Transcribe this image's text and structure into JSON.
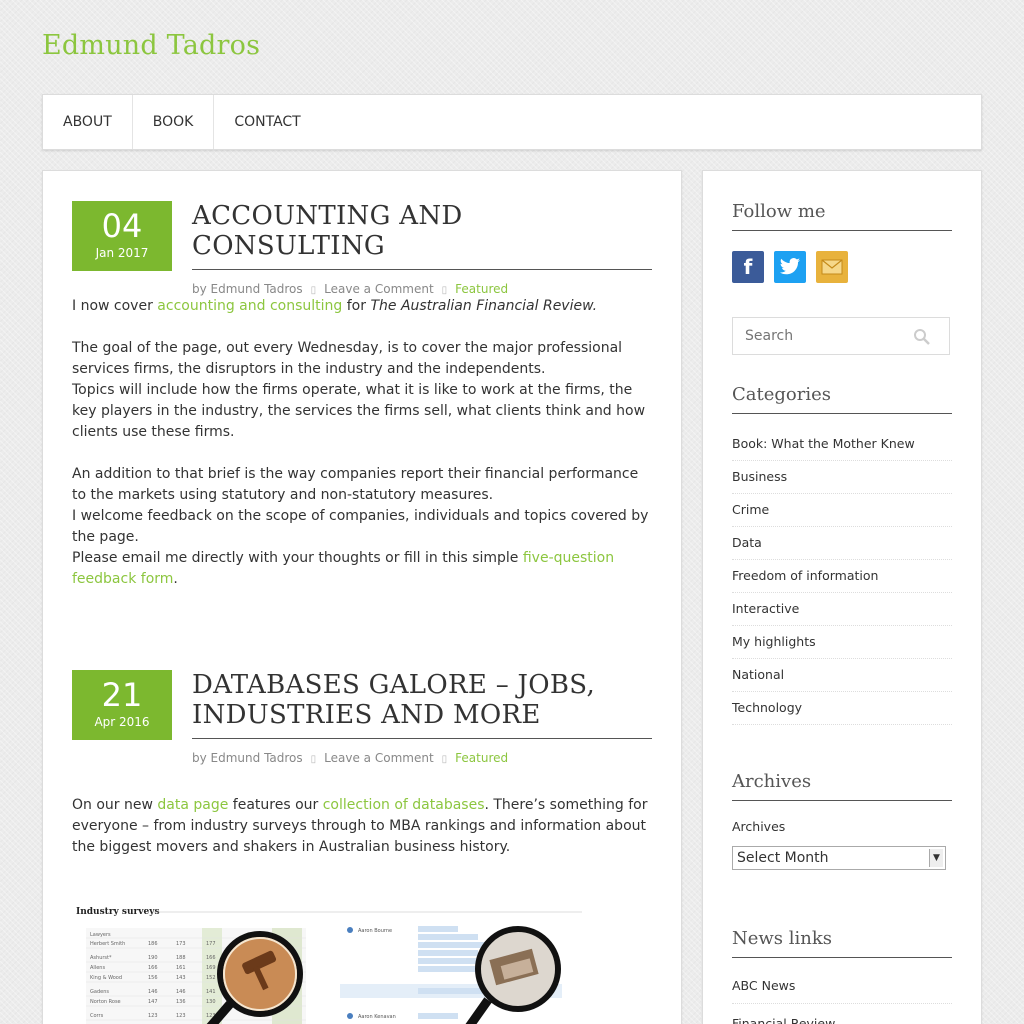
{
  "site": {
    "title": "Edmund Tadros"
  },
  "nav": {
    "items": [
      "ABOUT",
      "BOOK",
      "CONTACT"
    ]
  },
  "posts": [
    {
      "day": "04",
      "month": "Jan 2017",
      "title": "ACCOUNTING AND CONSULTING",
      "author": "by Edmund Tadros",
      "comment": "Leave a Comment",
      "category": "Featured",
      "p1_pre": "I now cover ",
      "p1_link": "accounting and consulting",
      "p1_mid": " for ",
      "p1_em": "The Australian Financial Review.",
      "p2a": "The goal of the page, out every Wednesday, is to cover the major professional services firms, the disruptors in the industry and the independents.",
      "p2b": "Topics will include how the firms operate, what it is like to work at the firms, the key players in the industry, the services the firms sell, what clients think and how clients use these firms.",
      "p3a": "An addition to that brief is the way companies report their financial performance to the markets using statutory and non-statutory measures.",
      "p3b": "I welcome feedback on the scope of companies, individuals and topics covered by the page.",
      "p3c_pre": "Please email me directly with your thoughts or fill in this simple ",
      "p3c_link": "five-question feedback form",
      "p3c_post": "."
    },
    {
      "day": "21",
      "month": "Apr 2016",
      "title": "DATABASES GALORE – JOBS, INDUSTRIES AND MORE",
      "author": "by Edmund Tadros",
      "comment": "Leave a Comment",
      "category": "Featured",
      "p1_pre": "On our new ",
      "p1_link": "data page",
      "p1_mid": " features our ",
      "p1_link2": "collection of databases",
      "p1_post": ". There’s something for everyone – from industry surveys through to MBA rankings and information about the biggest movers and shakers in Australian business history.",
      "image_heading": "Industry surveys"
    }
  ],
  "sidebar": {
    "follow_title": "Follow me",
    "social": [
      {
        "name": "facebook-icon",
        "glyph": "f"
      },
      {
        "name": "twitter-icon",
        "glyph": "t"
      },
      {
        "name": "email-icon",
        "glyph": "✉"
      }
    ],
    "search_placeholder": "Search",
    "categories_title": "Categories",
    "categories": [
      "Book: What the Mother Knew",
      "Business",
      "Crime",
      "Data",
      "Freedom of information",
      "Interactive",
      "My highlights",
      "National",
      "Technology"
    ],
    "archives_title": "Archives",
    "archives_label": "Archives",
    "archives_select": "Select Month",
    "news_title": "News links",
    "news": [
      "ABC News",
      "Financial Review"
    ]
  },
  "colors": {
    "accent": "#8cc63f",
    "badge": "#7cb82f"
  }
}
